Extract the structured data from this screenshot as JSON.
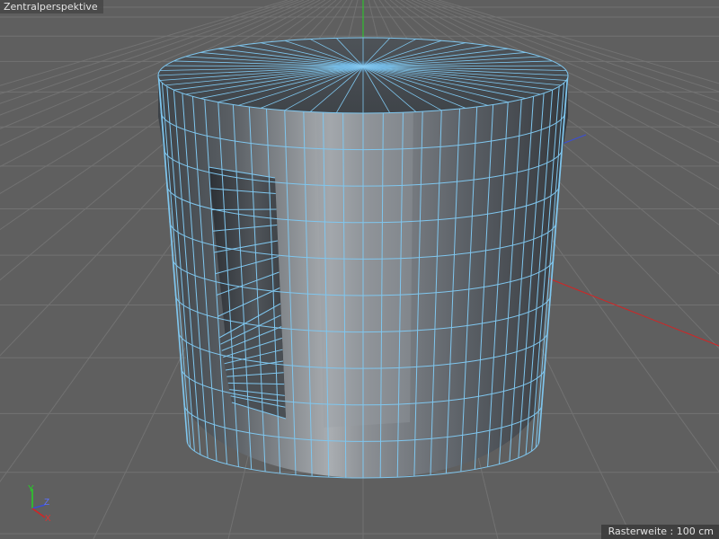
{
  "viewport": {
    "title": "Zentralperspektive",
    "grid_label": "Rasterweite : 100 cm"
  },
  "axis_gizmo": {
    "y_label": "Y",
    "z_label": "Z",
    "x_label": "X"
  },
  "colors": {
    "background": "#5f5f5f",
    "grid_line": "#727272",
    "wire": "#7fc6ee",
    "axis_x": "#d42424",
    "axis_y": "#26d026",
    "axis_z": "#3a4ed8",
    "selection_cap": "#5aaee6"
  }
}
